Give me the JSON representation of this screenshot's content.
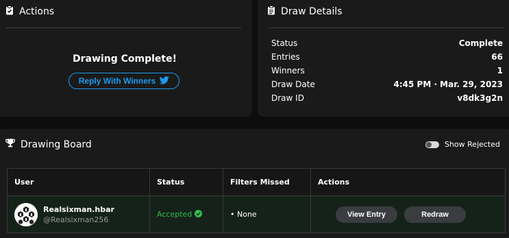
{
  "actions": {
    "title": "Actions",
    "complete_text": "Drawing Complete!",
    "reply_button_label": "Reply With Winners"
  },
  "details": {
    "title": "Draw Details",
    "rows": [
      {
        "label": "Status",
        "value": "Complete"
      },
      {
        "label": "Entries",
        "value": "66"
      },
      {
        "label": "Winners",
        "value": "1"
      },
      {
        "label": "Draw Date",
        "value": "4:45 PM · Mar. 29, 2023"
      },
      {
        "label": "Draw ID",
        "value": "v8dk3g2n"
      }
    ]
  },
  "board": {
    "title": "Drawing Board",
    "toggle_label": "Show Rejected",
    "columns": [
      "User",
      "Status",
      "Filters Missed",
      "Actions"
    ],
    "rows": [
      {
        "name": "Realsixman.hbar",
        "handle": "@Realsixman256",
        "status": "Accepted",
        "filters_missed": "• None",
        "view_label": "View Entry",
        "redraw_label": "Redraw"
      }
    ]
  },
  "colors": {
    "accent_twitter": "#1d9bf0",
    "accepted_green": "#2fbf4f",
    "card_bg": "#1a1a1a",
    "row_bg": "#15221a"
  },
  "icons": [
    "clipboard-check-icon",
    "clipboard-list-icon",
    "trophy-icon",
    "twitter-icon",
    "check-circle-icon"
  ]
}
